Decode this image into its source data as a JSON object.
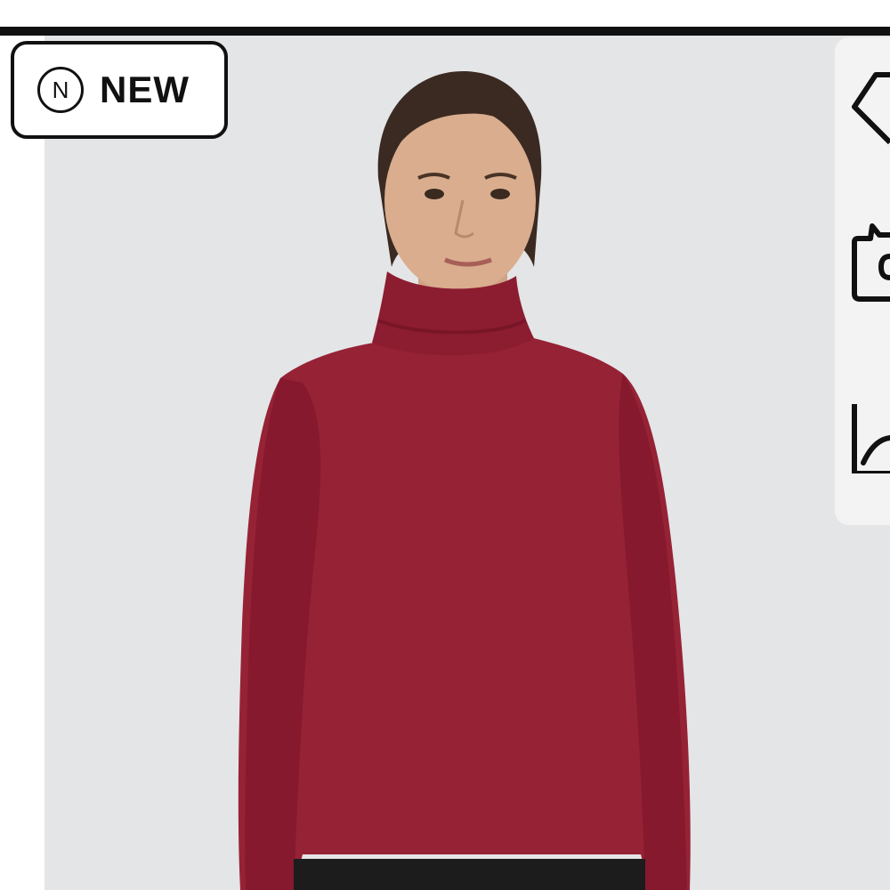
{
  "badge": {
    "icon_letter": "N",
    "label": "NEW"
  },
  "side_actions": [
    {
      "icon": "tag-icon",
      "action": "wishlist"
    },
    {
      "icon": "camera-icon",
      "action": "search-by-image"
    },
    {
      "icon": "chart-icon",
      "action": "price-history"
    }
  ],
  "product_image": {
    "description_color": "#962236",
    "background_color": "#e4e5e7"
  }
}
